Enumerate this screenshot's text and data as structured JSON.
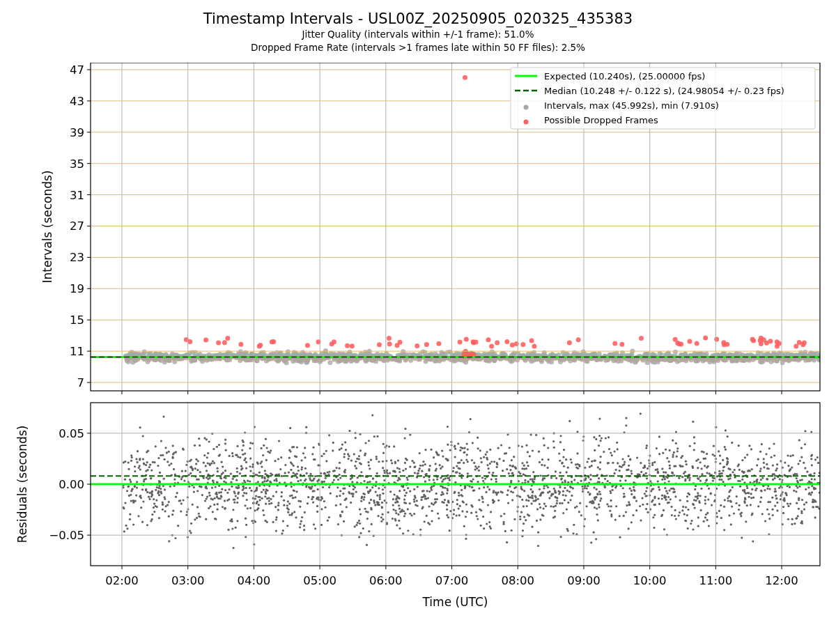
{
  "title": "Timestamp Intervals - USL00Z_20250905_020325_435383",
  "subtitles": [
    "Jitter Quality (intervals within +/-1 frame): 51.0%",
    "Dropped Frame Rate (intervals >1 frames late within 50 FF files): 2.5%"
  ],
  "charts": [
    {
      "chart_data": {
        "type": "scatter",
        "ylabel": "Intervals (seconds)",
        "xlim": [
          1.525,
          12.58
        ],
        "ylim": [
          5.93,
          47.89
        ],
        "grid": true,
        "legend": "upper right",
        "yticks": [
          {
            "value": 7,
            "label": "7"
          },
          {
            "value": 11,
            "label": "11"
          },
          {
            "value": 15,
            "label": "15"
          },
          {
            "value": 19,
            "label": "19"
          },
          {
            "value": 23,
            "label": "23"
          },
          {
            "value": 27,
            "label": "27"
          },
          {
            "value": 31,
            "label": "31"
          },
          {
            "value": 35,
            "label": "35"
          },
          {
            "value": 39,
            "label": "39"
          },
          {
            "value": 43,
            "label": "43"
          },
          {
            "value": 47,
            "label": "47"
          }
        ],
        "ref_lines": [
          {
            "axis": "y",
            "value": 10.24,
            "label": "Expected (10.240s), (25.00000 fps)",
            "color": "#00ff00",
            "line_style": "solid"
          },
          {
            "axis": "y",
            "value": 10.25,
            "label": "Median (10.248 +/- 0.122 s), (24.98054 +/- 0.23 fps)",
            "color": "#006400",
            "line_style": "dashed"
          }
        ]
      },
      "legend_points": [
        {
          "label": "Intervals, max (45.992s), min (7.910s)",
          "color": "#a8a8a8"
        },
        {
          "label": "Possible Dropped Frames",
          "color": "#ff6060"
        }
      ]
    },
    {
      "chart_data": {
        "type": "scatter",
        "xlabel": "Time (UTC)",
        "ylabel": "Residuals (seconds)",
        "xlim": [
          1.525,
          12.58
        ],
        "ylim": [
          -0.08,
          0.08
        ],
        "grid": true,
        "xticks": [
          {
            "value": 2,
            "label": "02:00"
          },
          {
            "value": 3,
            "label": "03:00"
          },
          {
            "value": 4,
            "label": "04:00"
          },
          {
            "value": 5,
            "label": "05:00"
          },
          {
            "value": 6,
            "label": "06:00"
          },
          {
            "value": 7,
            "label": "07:00"
          },
          {
            "value": 8,
            "label": "08:00"
          },
          {
            "value": 9,
            "label": "09:00"
          },
          {
            "value": 10,
            "label": "10:00"
          },
          {
            "value": 11,
            "label": "11:00"
          },
          {
            "value": 12,
            "label": "12:00"
          }
        ],
        "yticks": [
          {
            "value": -0.05,
            "label": "−0.05"
          },
          {
            "value": 0,
            "label": "0.00"
          },
          {
            "value": 0.05,
            "label": "0.05"
          }
        ],
        "ref_lines": [
          {
            "axis": "y",
            "value": 0,
            "color": "#00ff00",
            "line_style": "solid"
          },
          {
            "axis": "y",
            "value": 0.008,
            "color": "#006400",
            "line_style": "dashed"
          }
        ]
      }
    }
  ]
}
